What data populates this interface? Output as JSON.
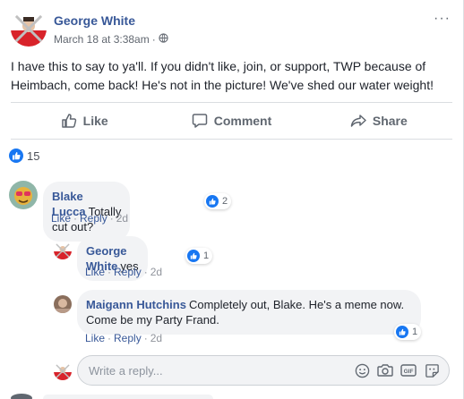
{
  "post": {
    "author": "George White",
    "timestamp": "March 18 at 3:38am",
    "meta_separator": "·",
    "privacy_icon": "globe-icon",
    "more_icon": "···",
    "text": "I have this to say to ya'll. If you didn't like, join, or support, TWP because of Heimbach, come back! He's not in the picture! We've shed our water weight!"
  },
  "actions": {
    "like": "Like",
    "comment": "Comment",
    "share": "Share"
  },
  "reactions": {
    "count": "15"
  },
  "comments": [
    {
      "author": "Blake Lucca",
      "text": "Totally cut out?",
      "like_count": "2",
      "links": {
        "like": "Like",
        "reply": "Reply",
        "time": "2d"
      }
    },
    {
      "author": "George White",
      "text": "yes",
      "like_count": "1",
      "links": {
        "like": "Like",
        "reply": "Reply",
        "time": "2d"
      }
    },
    {
      "author": "Maigann Hutchins",
      "text": "Completely out, Blake. He's a meme now. Come be my Party Frand.",
      "like_count": "1",
      "links": {
        "like": "Like",
        "reply": "Reply",
        "time": "2d"
      }
    }
  ],
  "reply": {
    "placeholder": "Write a reply...",
    "tool_icons": [
      "emoji-icon",
      "camera-icon",
      "gif-icon",
      "sticker-icon"
    ],
    "gif_label": "GIF"
  },
  "colors": {
    "link": "#385898",
    "like_blue": "#1877f2",
    "bubble_bg": "#f2f3f5",
    "muted": "#606770"
  }
}
